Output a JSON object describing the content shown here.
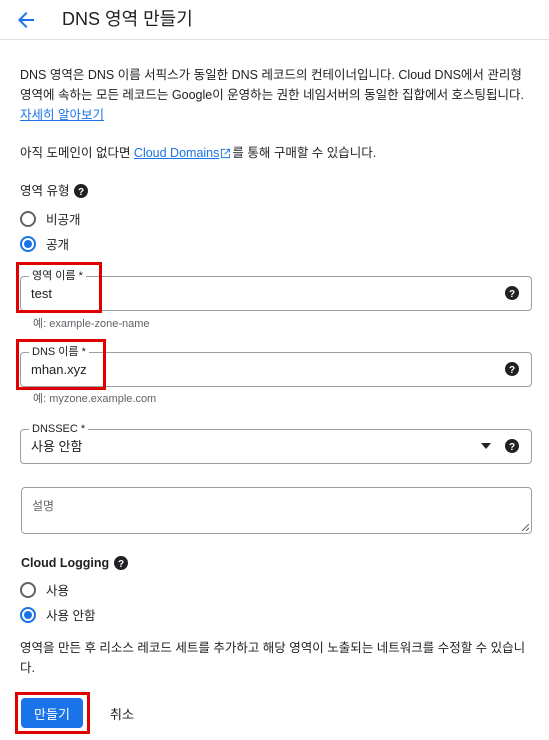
{
  "header": {
    "title": "DNS 영역 만들기"
  },
  "intro": {
    "text": "DNS 영역은 DNS 이름 서픽스가 동일한 DNS 레코드의 컨테이너입니다. Cloud DNS에서 관리형 영역에 속하는 모든 레코드는 Google이 운영하는 권한 네임서버의 동일한 집합에서 호스팅됩니다.",
    "learn_more": "자세히 알아보기"
  },
  "domain_note": {
    "before": "아직 도메인이 없다면 ",
    "link": "Cloud Domains",
    "after": "를 통해 구매할 수 있습니다."
  },
  "zone_type": {
    "label": "영역 유형",
    "options": [
      {
        "label": "비공개",
        "selected": false
      },
      {
        "label": "공개",
        "selected": true
      }
    ]
  },
  "zone_name": {
    "label": "영역 이름 *",
    "value": "test",
    "hint": "예: example-zone-name"
  },
  "dns_name": {
    "label": "DNS 이름 *",
    "value": "mhan.xyz",
    "hint": "예: myzone.example.com"
  },
  "dnssec": {
    "label": "DNSSEC *",
    "value": "사용 안함"
  },
  "description": {
    "placeholder": "설명"
  },
  "cloud_logging": {
    "label": "Cloud Logging",
    "options": [
      {
        "label": "사용",
        "selected": false
      },
      {
        "label": "사용 안함",
        "selected": true
      }
    ]
  },
  "footer_note": "영역을 만든 후 리소스 레코드 세트를 추가하고 해당 영역이 노출되는 네트워크를 수정할 수 있습니다.",
  "actions": {
    "create": "만들기",
    "cancel": "취소"
  },
  "colors": {
    "accent": "#1a73e8",
    "highlight": "#e00000"
  }
}
